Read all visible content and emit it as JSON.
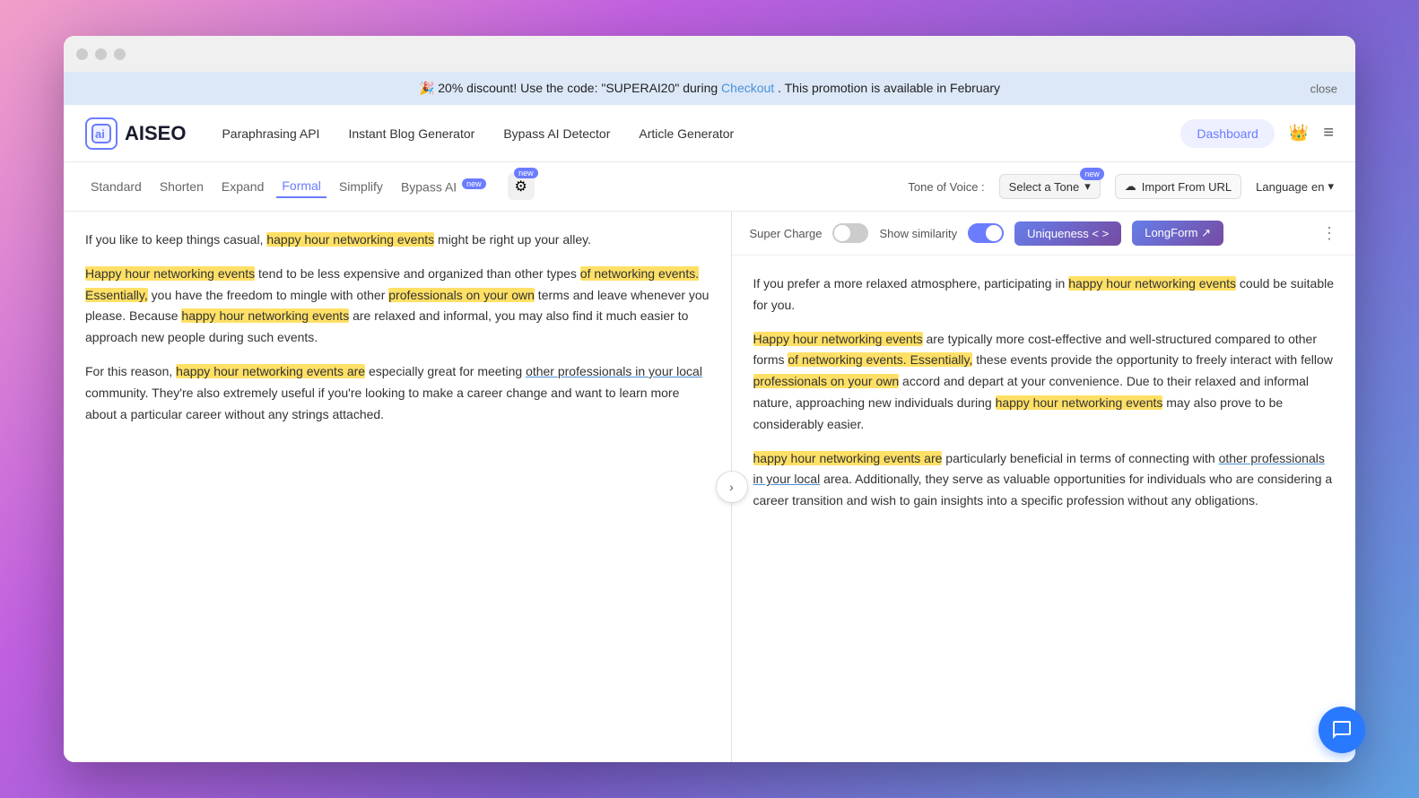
{
  "window": {
    "titlebar_dots": [
      "dot1",
      "dot2",
      "dot3"
    ]
  },
  "banner": {
    "emoji": "🎉",
    "text": "20% discount! Use the code: \"SUPERAI20\" during ",
    "link_text": "Checkout",
    "text2": ". This promotion is available in February",
    "close_label": "close"
  },
  "navbar": {
    "logo_icon": "Ⓐ",
    "logo_text": "AISEO",
    "links": [
      {
        "label": "Paraphrasing API"
      },
      {
        "label": "Instant Blog Generator"
      },
      {
        "label": "Bypass AI Detector"
      },
      {
        "label": "Article Generator"
      }
    ],
    "dashboard_label": "Dashboard",
    "crown_icon": "👑",
    "menu_icon": "≡"
  },
  "toolbar": {
    "tabs": [
      {
        "label": "Standard",
        "active": false
      },
      {
        "label": "Shorten",
        "active": false
      },
      {
        "label": "Expand",
        "active": false
      },
      {
        "label": "Formal",
        "active": true
      },
      {
        "label": "Simplify",
        "active": false
      },
      {
        "label": "Bypass AI",
        "active": false,
        "has_new": true
      }
    ],
    "settings_icon": "⚙",
    "new_badge": "new",
    "tone_label": "Tone of Voice :",
    "tone_placeholder": "Select a Tone",
    "tone_new_badge": "new",
    "import_label": "Import From URL",
    "import_icon": "☁",
    "language_label": "Language",
    "language_value": "en",
    "language_arrow": "▾"
  },
  "right_toolbar": {
    "super_charge_label": "Super Charge",
    "show_similarity_label": "Show similarity",
    "uniqueness_label": "Uniqueness < >",
    "longform_label": "LongForm ↗",
    "dots": "⋮"
  },
  "left_text": {
    "para1": "If you like to keep things casual, happy hour networking events might be right up your alley.",
    "para1_highlight": "happy hour networking events",
    "para2_before": "",
    "para2": "Happy hour networking events tend to be less expensive and organized than other types of networking events. Essentially, you have the freedom to mingle with other professionals on your own terms and leave whenever you please. Because happy hour networking events are relaxed and informal, you may also find it much easier to approach new people during such events.",
    "para3": "For this reason, happy hour networking events are especially great for meeting other professionals in your local community. They're also extremely useful if you're looking to make a career change and want to learn more about a particular career without any strings attached."
  },
  "right_text": {
    "para1": "If you prefer a more relaxed atmosphere, participating in happy hour networking events could be suitable for you.",
    "para2": "Happy hour networking events are typically more cost-effective and well-structured compared to other forms of networking events. Essentially, these events provide the opportunity to freely interact with fellow professionals on your own accord and depart at your convenience. Due to their relaxed and informal nature, approaching new individuals during happy hour networking events may also prove to be considerably easier.",
    "para3": "happy hour networking events are particularly beneficial in terms of connecting with other professionals in your local area. Additionally, they serve as valuable opportunities for individuals who are considering a career transition and wish to gain insights into a specific profession without any obligations."
  },
  "chat_btn": "💬"
}
